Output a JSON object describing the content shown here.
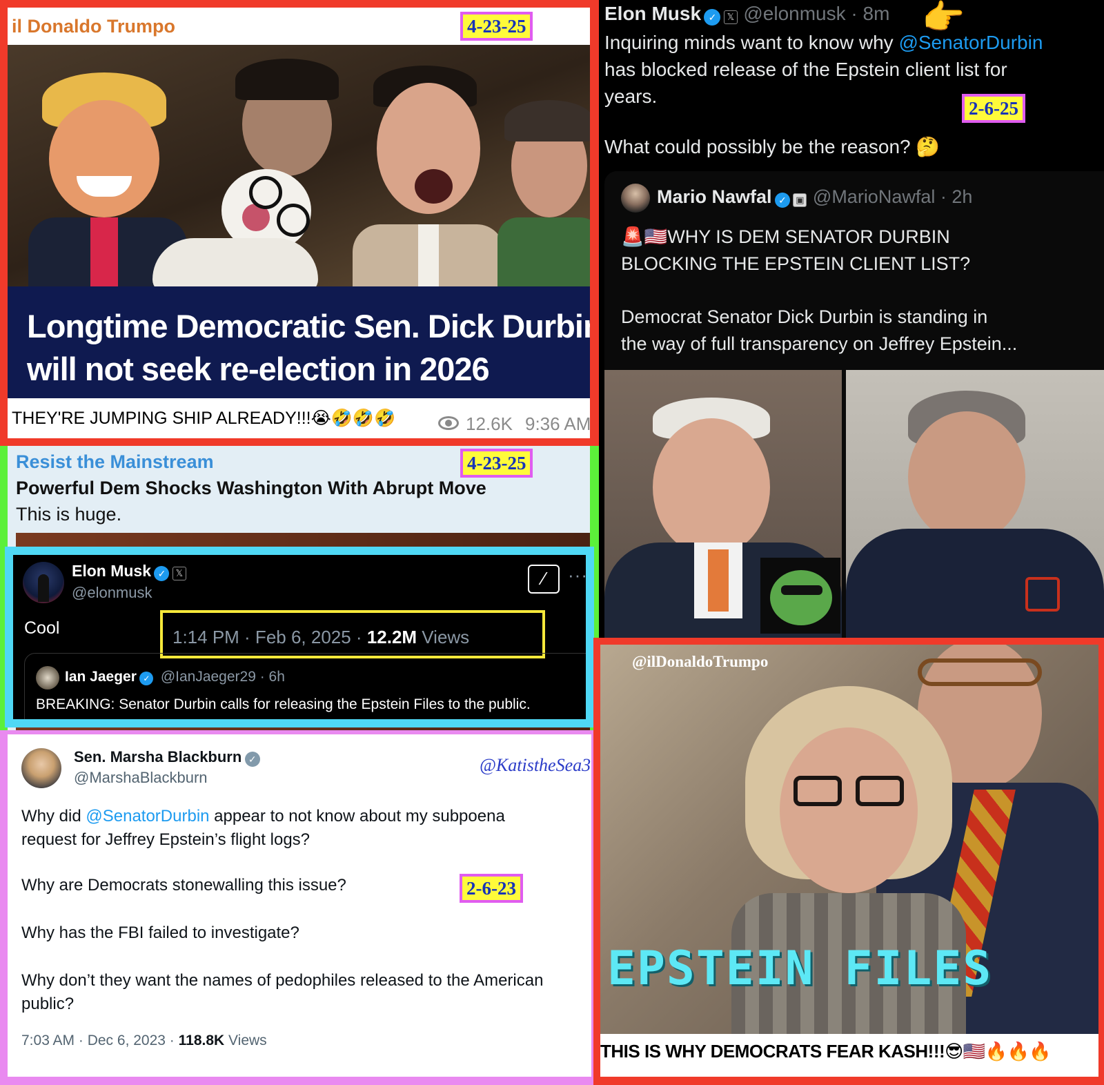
{
  "panel_trumpo": {
    "channel": "il Donaldo Trumpo",
    "date_tag": "4-23-25",
    "headline_line1": "Longtime Democratic Sen. Dick Durbin",
    "headline_line2": "will not seek re-election in 2026",
    "caption": "THEY'RE JUMPING SHIP ALREADY!!!😭🤣🤣🤣",
    "views": "12.6K",
    "time": "9:36 AM"
  },
  "panel_resist": {
    "channel": "Resist the Mainstream",
    "date_tag": "4-23-25",
    "title": "Powerful Dem Shocks Washington With Abrupt Move",
    "subtitle": "This is huge."
  },
  "tweet_musk_cool": {
    "name": "Elon Musk",
    "handle": "@elonmusk",
    "text": "Cool",
    "timestamp": "1:14 PM · Feb 6, 2025 · ",
    "views_count": "12.2M",
    "views_label": " Views",
    "quoted_name": "Ian Jaeger",
    "quoted_handle": "@IanJaeger29 · 6h",
    "quoted_text": "BREAKING: Senator Durbin calls for releasing the Epstein Files to the public."
  },
  "tweet_blackburn": {
    "name": "Sen. Marsha Blackburn",
    "handle": "@MarshaBlackburn",
    "watermark": "@KatistheSea3",
    "line1_a": "Why did ",
    "mention": "@SenatorDurbin",
    "line1_b": " appear to not know about my subpoena",
    "line2": "request for Jeffrey Epstein’s flight logs?",
    "p2": "Why are Democrats stonewalling this issue?",
    "date_tag": "2-6-23",
    "p3": "Why has the FBI failed to investigate?",
    "p4_line1": "Why don’t they want the names of pedophiles released to the American",
    "p4_line2": "public?",
    "timestamp": "7:03 AM · Dec 6, 2023 · ",
    "views_count": "118.8K",
    "views_label": " Views"
  },
  "tweet_musk_durbin": {
    "name": "Elon Musk",
    "handle": "@elonmusk · 8m",
    "emoji": "👉",
    "line1_a": "Inquiring minds want to know why ",
    "mention": "@SenatorDurbin",
    "line2": "has blocked release of the Epstein client list for",
    "line3": "years.",
    "date_tag": "2-6-25",
    "question": "What could possibly be the reason? 🤔",
    "quoted_name": "Mario Nawfal",
    "quoted_handle": "@MarioNawfal · 2h",
    "quoted_title1": "🚨🇺🇸WHY IS DEM SENATOR DURBIN",
    "quoted_title2": "BLOCKING THE EPSTEIN CLIENT LIST?",
    "quoted_body1": "Democrat Senator Dick Durbin is standing in",
    "quoted_body2": "the way of full transparency on Jeffrey Epstein..."
  },
  "panel_epstein_video": {
    "watermark": "@ilDonaldoTrumpo",
    "overlay_text": "EPSTEIN FILES",
    "caption": "THIS IS WHY DEMOCRATS FEAR KASH!!!😎🇺🇸🔥🔥🔥"
  },
  "colors": {
    "red_frame": "#f03a2a",
    "green_frame": "#5cf03a",
    "cyan_frame": "#4fd8f5",
    "pink_frame": "#e98af0",
    "telegram_orange": "#d9772c",
    "telegram_blue": "#3a8fd8",
    "x_blue": "#1d9bf0",
    "tag_yellow": "#fffb3a"
  }
}
